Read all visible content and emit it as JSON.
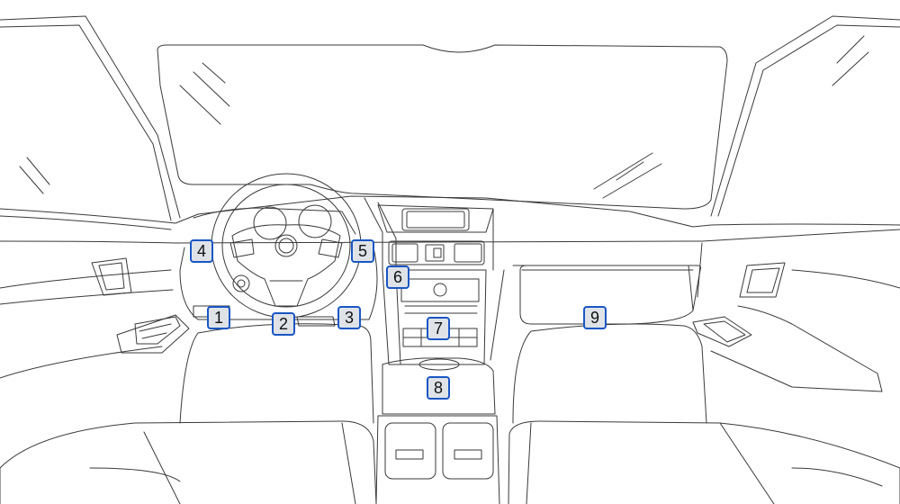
{
  "colors": {
    "marker_border": "#1a56c4",
    "marker_fill": "#dfe3e8",
    "line": "#3a3a3a"
  },
  "markers": [
    {
      "id": "marker-1",
      "label": "1"
    },
    {
      "id": "marker-2",
      "label": "2"
    },
    {
      "id": "marker-3",
      "label": "3"
    },
    {
      "id": "marker-4",
      "label": "4"
    },
    {
      "id": "marker-5",
      "label": "5"
    },
    {
      "id": "marker-6",
      "label": "6"
    },
    {
      "id": "marker-7",
      "label": "7"
    },
    {
      "id": "marker-8",
      "label": "8"
    },
    {
      "id": "marker-9",
      "label": "9"
    }
  ]
}
